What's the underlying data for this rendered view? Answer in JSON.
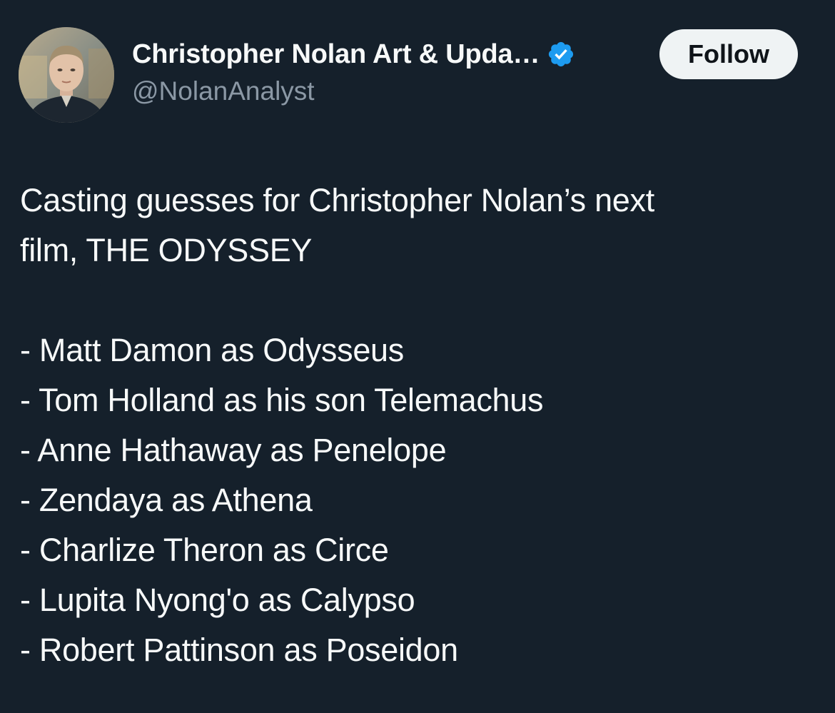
{
  "author": {
    "display_name": "Christopher Nolan Art & Upda…",
    "handle": "@NolanAnalyst",
    "verified": true,
    "avatar_icon": "profile-photo"
  },
  "actions": {
    "follow_label": "Follow"
  },
  "tweet": {
    "intro_lines": [
      "Casting guesses for Christopher Nolan’s next",
      "film, THE ODYSSEY"
    ],
    "cast_lines": [
      "- Matt Damon as Odysseus",
      "- Tom Holland as his son Telemachus",
      "- Anne Hathaway as Penelope",
      "- Zendaya as Athena",
      "- Charlize Theron as Circe",
      "- Lupita Nyong'o as Calypso",
      "- Robert Pattinson as Poseidon"
    ]
  },
  "colors": {
    "background": "#15202b",
    "text": "#f7f9f9",
    "secondary_text": "#8b98a5",
    "verified_blue": "#1d9bf0",
    "follow_bg": "#eff3f4"
  }
}
